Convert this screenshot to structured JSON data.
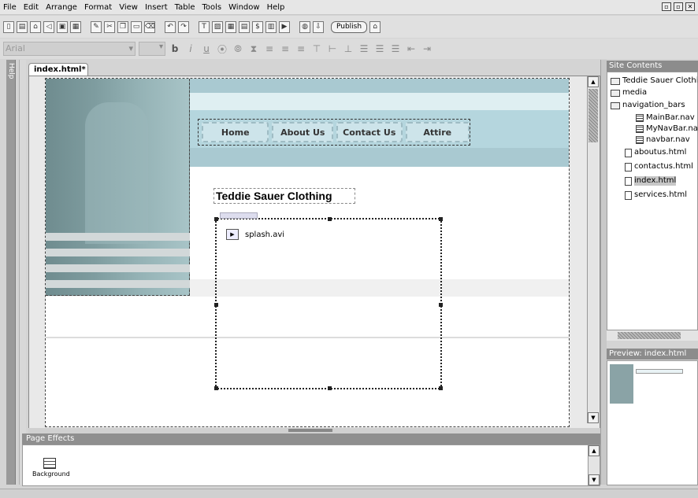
{
  "menu": [
    "File",
    "Edit",
    "Arrange",
    "Format",
    "View",
    "Insert",
    "Table",
    "Tools",
    "Window",
    "Help"
  ],
  "toolbar": {
    "publish_label": "Publish"
  },
  "format": {
    "font_value": "Arial",
    "bold": "b",
    "italic": "i",
    "underline": "u"
  },
  "help_label": "Help",
  "doc_tab": "index.html*",
  "page": {
    "nav_buttons": [
      "Home",
      "About Us",
      "Contact Us",
      "Attire"
    ],
    "heading": "Teddie Sauer Clothing",
    "media_file": "splash.avi"
  },
  "page_effects": {
    "title": "Page Effects",
    "background_label": "Background"
  },
  "site_contents": {
    "title": "Site Contents",
    "items": [
      "Teddie Sauer Clothi",
      "media",
      "navigation_bars",
      "MainBar.nav",
      "MyNavBar.na",
      "navbar.nav",
      "aboutus.html",
      "contactus.html",
      "index.html",
      "services.html"
    ]
  },
  "preview": {
    "title": "Preview: index.html"
  }
}
